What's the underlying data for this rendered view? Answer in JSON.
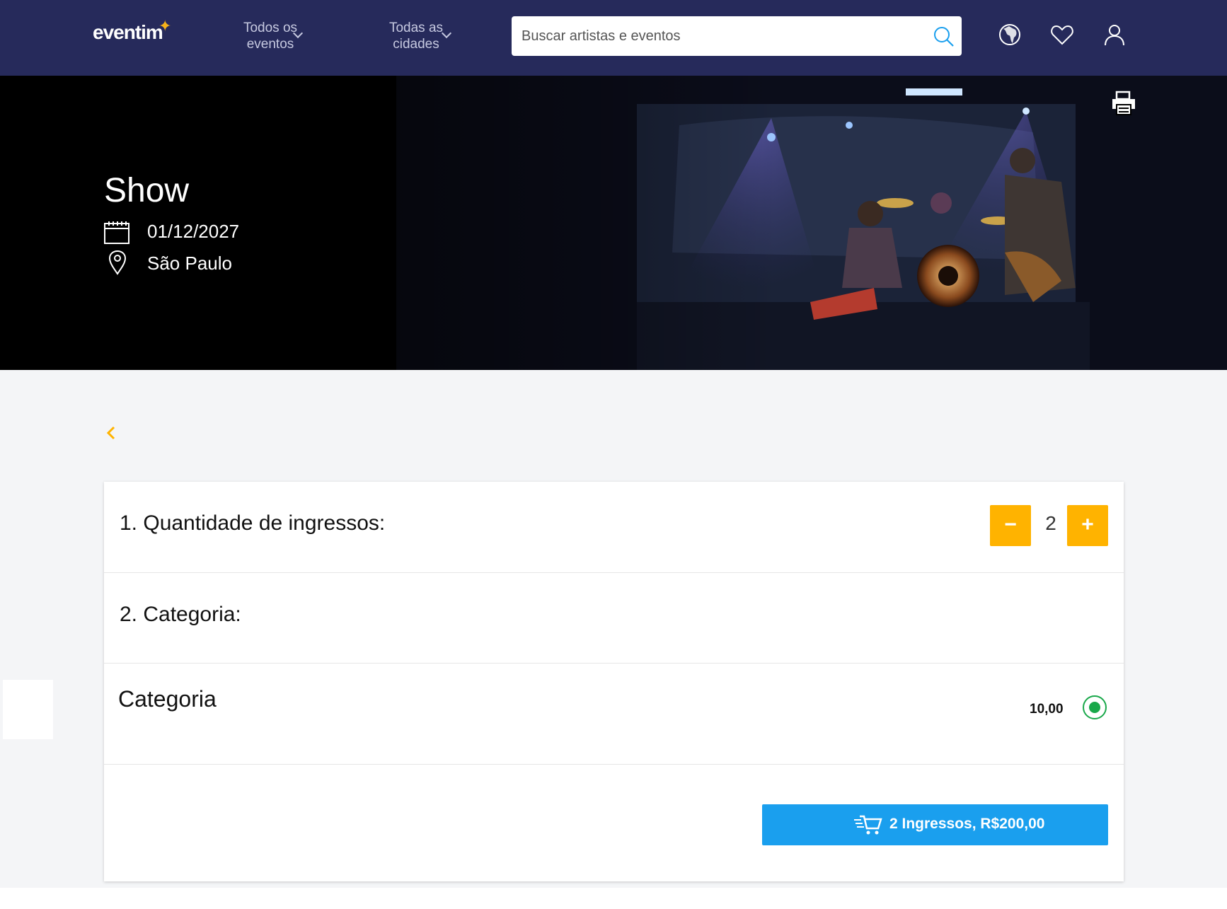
{
  "header": {
    "logo": "eventim",
    "nav": [
      {
        "label_line1": "Todos os",
        "label_line2": "eventos"
      },
      {
        "label_line1": "Todas as",
        "label_line2": "cidades"
      }
    ],
    "search_placeholder": "Buscar artistas e eventos"
  },
  "hero": {
    "title": "Show",
    "date": "01/12/2027",
    "city": "São Paulo"
  },
  "booking": {
    "step1_title": "1. Quantidade de ingressos:",
    "minus": "−",
    "plus": "+",
    "quantity": "2",
    "step2_title": "2. Categoria:",
    "category_name": "Categoria",
    "category_price": "10,00",
    "category_selected": true,
    "cta_label": "2 Ingressos, R$200,00"
  },
  "colors": {
    "header_bg": "#262a5b",
    "accent_orange": "#ffb300",
    "cta_blue": "#1a9fee",
    "radio_green": "#19a84a"
  }
}
